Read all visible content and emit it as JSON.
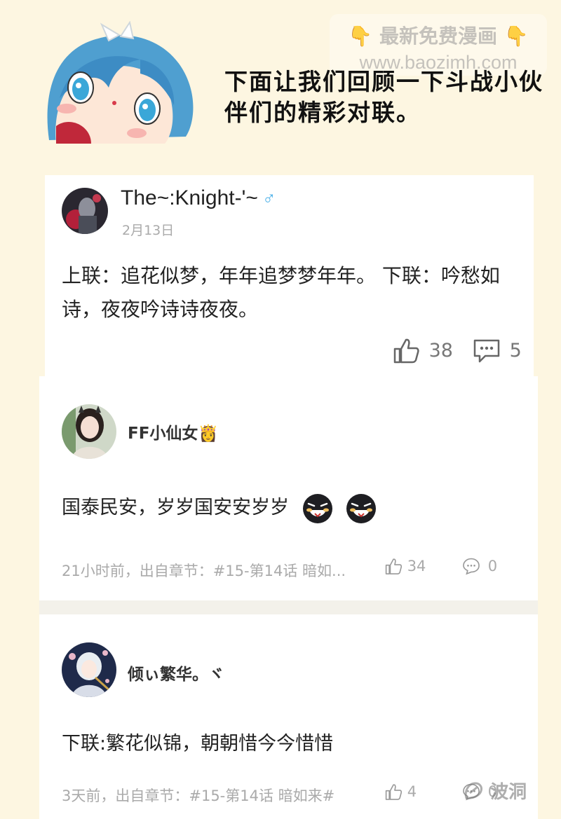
{
  "header": {
    "narration": "下面让我们回顾一下斗战小伙伴们的精彩对联。",
    "watermark_line1": "最新免费漫画",
    "watermark_line2": "www.baozimh.com",
    "watermark_hand": "👇"
  },
  "comments": [
    {
      "username": "The~:Knight-'~",
      "gender_icon": "♂",
      "date": "2月13日",
      "text": "上联：追花似梦，年年追梦梦年年。 下联：吟愁如诗，夜夜吟诗诗夜夜。",
      "likes": "38",
      "replies": "5"
    },
    {
      "username": "FF小仙女",
      "name_emoji": "👸",
      "text": "国泰民安，岁岁国安安岁岁",
      "meta": "21小时前，出自章节：#15-第14话 暗如...",
      "likes": "34",
      "replies": "0"
    },
    {
      "username": "倾ぃ繁华。ヾ",
      "text": "下联:繁花似锦，朝朝惜今今惜惜",
      "meta": "3天前，出自章节：#15-第14话 暗如来#",
      "likes": "4",
      "replies": "0"
    }
  ],
  "source_watermark": "波洞",
  "colors": {
    "background": "#fdf6e1",
    "card": "#ffffff",
    "male_icon": "#4ab0e8",
    "meta_text": "#aaaaaa"
  }
}
